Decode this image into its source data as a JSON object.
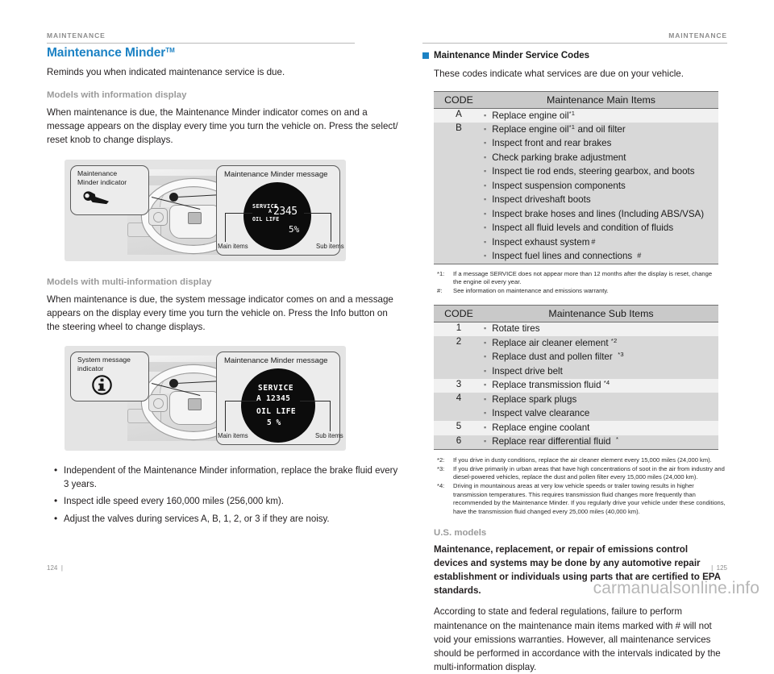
{
  "running_head": {
    "left": "MAINTENANCE",
    "right": "MAINTENANCE"
  },
  "left_column": {
    "title": "Maintenance Minder",
    "title_tm": "TM",
    "lede": "Reminds you when indicated maintenance service is due.",
    "section1": {
      "subhead": "Models with information display",
      "body": "When maintenance is due, the Maintenance Minder indicator comes on and a message appears on the display every time you turn the vehicle on. Press the select/ reset knob to change displays.",
      "figure": {
        "callout_label": "Maintenance\nMinder indicator",
        "callout_icon": "wrench-icon",
        "display_title": "Maintenance Minder message",
        "display_service_label": "SERVICE",
        "display_code": "A",
        "display_mileage": "2345",
        "display_oil_label": "OIL LIFE",
        "display_oil_value": "5%",
        "caption_left": "Main items",
        "caption_right": "Sub items"
      }
    },
    "section2": {
      "subhead": "Models with multi-information display",
      "body": "When maintenance is due, the system message indicator comes on and a message appears on the display every time you turn the vehicle on. Press the Info button on the steering wheel to change displays.",
      "figure": {
        "callout_label": "System message\nindicator",
        "callout_icon": "info-circle-icon",
        "display_title": "Maintenance Minder message",
        "display_service_label": "SERVICE",
        "display_code_line": "A 12345",
        "display_oil_label": "OIL LIFE",
        "display_oil_value": "5 %",
        "caption_left": "Main items",
        "caption_right": "Sub items"
      }
    },
    "bullets": [
      "Independent of the Maintenance Minder information, replace the brake fluid every 3 years.",
      "Inspect idle speed every 160,000 miles (256,000 km).",
      "Adjust the valves during services A, B, 1, 2, or 3 if they are noisy."
    ]
  },
  "right_column": {
    "heading": "Maintenance Minder Service Codes",
    "intro": "These codes indicate what services are due on your vehicle.",
    "main_table": {
      "header_code": "CODE",
      "header_items": "Maintenance Main Items",
      "rows": [
        {
          "code": "A",
          "items": [
            {
              "text": "Replace engine oil",
              "ref": "*1"
            }
          ]
        },
        {
          "code": "B",
          "items": [
            {
              "text": "Replace engine oil",
              "ref": "*1",
              "tail": "and oil filter"
            },
            {
              "text": "Inspect front and rear brakes"
            },
            {
              "text": "Check parking brake adjustment"
            },
            {
              "text": "Inspect tie rod ends, steering gearbox, and boots"
            },
            {
              "text": "Inspect suspension components"
            },
            {
              "text": "Inspect driveshaft boots"
            },
            {
              "text": "Inspect brake hoses and lines (Including ABS/VSA)"
            },
            {
              "text": "Inspect all fluid levels and condition of fluids"
            },
            {
              "text": "Inspect exhaust system",
              "hash": "#"
            },
            {
              "text": "Inspect fuel lines and connections",
              "hash": "#"
            }
          ]
        }
      ]
    },
    "main_footnotes": [
      {
        "key": "*1:",
        "text": "If a message SERVICE does not appear more than 12 months after the display is reset, change the engine oil every year."
      },
      {
        "key": "#:",
        "text": "See information on maintenance and emissions warranty."
      }
    ],
    "sub_table": {
      "header_code": "CODE",
      "header_items": "Maintenance Sub Items",
      "rows": [
        {
          "code": "1",
          "items": [
            {
              "text": "Rotate tires"
            }
          ]
        },
        {
          "code": "2",
          "items": [
            {
              "text": "Replace air cleaner element",
              "ref": "*2"
            },
            {
              "text": "Replace dust and pollen filter",
              "ref": "*3"
            },
            {
              "text": "Inspect drive belt"
            }
          ]
        },
        {
          "code": "3",
          "items": [
            {
              "text": "Replace transmission fluid",
              "ref": "*4"
            }
          ]
        },
        {
          "code": "4",
          "items": [
            {
              "text": "Replace spark plugs"
            },
            {
              "text": "Inspect valve clearance"
            }
          ]
        },
        {
          "code": "5",
          "items": [
            {
              "text": "Replace engine coolant"
            }
          ]
        },
        {
          "code": "6",
          "items": [
            {
              "text": "Replace rear differential fluid",
              "ref": "*"
            }
          ]
        }
      ]
    },
    "sub_footnotes": [
      {
        "key": "*2:",
        "text": "If you drive in dusty conditions, replace the air cleaner element every 15,000 miles (24,000 km)."
      },
      {
        "key": "*3:",
        "text": "If you drive primarily in urban areas that have high concentrations of soot in the air from industry and diesel-powered vehicles, replace the dust and pollen filter every 15,000 miles (24,000 km)."
      },
      {
        "key": "*4:",
        "text": "Driving in mountainous areas at very low vehicle speeds or trailer towing results in higher transmission temperatures. This requires transmission fluid changes more frequently than recommended by the Maintenance Minder. If you regularly drive your vehicle under these conditions, have the transmission fluid changed every 25,000 miles (40,000 km)."
      }
    ],
    "us_models": {
      "subhead": "U.S. models",
      "bold": "Maintenance, replacement, or repair of emissions control devices and systems may be done by any automotive repair establishment or individuals using parts that are certified to EPA standards.",
      "body": "According to state and federal regulations, failure to perform maintenance on the maintenance main items marked with # will not void your emissions warranties. However, all maintenance services should be performed in accordance with the intervals indicated by the multi-information display."
    }
  },
  "footer": {
    "page_left": "124",
    "page_left_bar": "|",
    "page_right_bar": "|",
    "page_right": "125",
    "watermark": "carmanualsonline.info"
  },
  "colors": {
    "accent_blue": "#1c82c4",
    "table_header": "#c9c9c9",
    "row_shade": "#d8d8d8",
    "row_plain": "#f1f1f1",
    "figure_bg": "#e4e4e4",
    "muted_text": "#9a9a9a"
  }
}
